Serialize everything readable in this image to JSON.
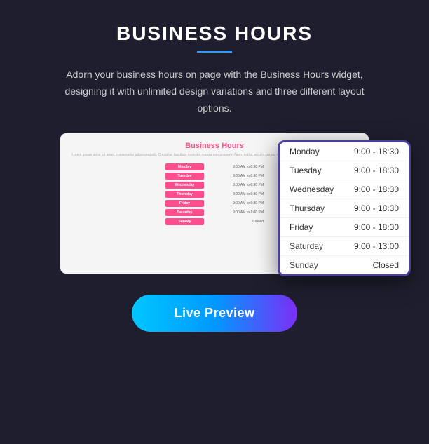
{
  "page": {
    "title": "BUSINESS HOURS",
    "underline_color": "#3399ff",
    "description": "Adorn your business hours on page with the Business Hours widget, designing it with unlimited design variations and three different layout options.",
    "bg_card": {
      "title": "Business Hours",
      "subtitle_text": "Lorem ipsum dolor sit amet, consectetur adipiscing elit. Curabitur faucibus molestie massa non posuere. Nam mattis, arcu in cursus sodales, massa ante blandit leo, vel egestas augue.",
      "rows": [
        {
          "day": "Monday",
          "time": "9:00 AM to 6:30 PM",
          "color": "#ff4d8d"
        },
        {
          "day": "Tuesday",
          "time": "9:00 AM to 6:30 PM",
          "color": "#ff4d8d"
        },
        {
          "day": "Wednesday",
          "time": "9:00 AM to 6:30 PM",
          "color": "#ff4d8d"
        },
        {
          "day": "Thursday",
          "time": "9:00 AM to 6:30 PM",
          "color": "#ff4d8d"
        },
        {
          "day": "Friday",
          "time": "9:00 AM to 6:30 PM",
          "color": "#ff4d8d"
        },
        {
          "day": "Saturday",
          "time": "9:00 AM to 1:00 PM",
          "color": "#ff4d8d"
        },
        {
          "day": "Sunday",
          "time": "Closed",
          "color": "#ff4d8d"
        }
      ]
    },
    "widget": {
      "rows": [
        {
          "day": "Monday",
          "time": "9:00 - 18:30"
        },
        {
          "day": "Tuesday",
          "time": "9:00 - 18:30"
        },
        {
          "day": "Wednesday",
          "time": "9:00 - 18:30"
        },
        {
          "day": "Thursday",
          "time": "9:00 - 18:30"
        },
        {
          "day": "Friday",
          "time": "9:00 - 18:30"
        },
        {
          "day": "Saturday",
          "time": "9:00 - 13:00"
        },
        {
          "day": "Sunday",
          "time": "Closed"
        }
      ]
    },
    "live_preview_button": "Live Preview"
  }
}
